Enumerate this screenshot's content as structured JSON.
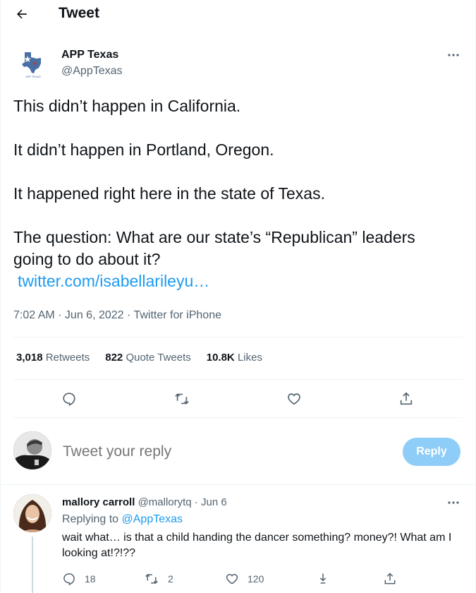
{
  "header": {
    "title": "Tweet"
  },
  "tweet": {
    "author_name": "APP Texas",
    "author_handle": "@AppTexas",
    "avatar_text": "APP TEXAS",
    "lines": [
      "This didn’t happen in California.",
      "It didn’t happen in Portland, Oregon.",
      "It happened right here in the state of Texas.",
      "The question: What are our state’s “Republican” leaders going to do about it?"
    ],
    "link": "twitter.com/isabellarileyu…",
    "time": "7:02 AM",
    "date": "Jun 6, 2022",
    "source": "Twitter for iPhone",
    "stats": {
      "retweets": "3,018",
      "retweets_label": "Retweets",
      "quotes": "822",
      "quotes_label": "Quote Tweets",
      "likes": "10.8K",
      "likes_label": "Likes"
    }
  },
  "composer": {
    "placeholder": "Tweet your reply",
    "button": "Reply"
  },
  "reply": {
    "name": "mallory carroll",
    "handle": "@mallorytq",
    "date": "Jun 6",
    "replying_to_label": "Replying to",
    "replying_to": "@AppTexas",
    "text": "wait what… is that a child handing the dancer something? money?! What am I looking at!?!??",
    "replies": "18",
    "retweets": "2",
    "likes": "120"
  },
  "colors": {
    "accent": "#1d9bf0",
    "reply_button": "#8ecdf8",
    "muted": "#536471"
  },
  "icons": [
    "back-arrow-icon",
    "more-icon",
    "reply-icon",
    "retweet-icon",
    "like-icon",
    "share-icon",
    "download-icon"
  ]
}
